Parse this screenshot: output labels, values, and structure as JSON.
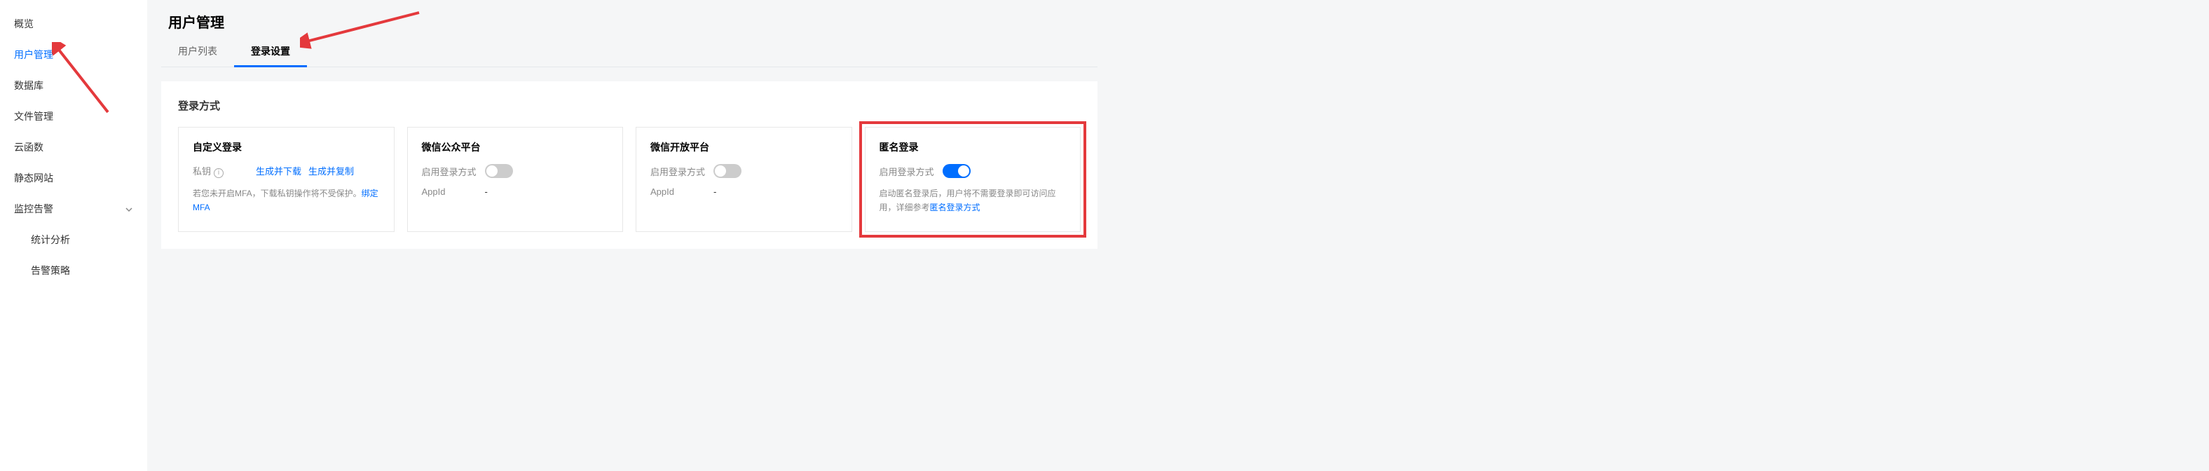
{
  "sidebar": {
    "items": [
      {
        "label": "概览",
        "active": false
      },
      {
        "label": "用户管理",
        "active": true
      },
      {
        "label": "数据库",
        "active": false
      },
      {
        "label": "文件管理",
        "active": false
      },
      {
        "label": "云函数",
        "active": false
      },
      {
        "label": "静态网站",
        "active": false
      },
      {
        "label": "监控告警",
        "active": false,
        "expandable": true
      },
      {
        "label": "统计分析",
        "active": false,
        "sub": true
      },
      {
        "label": "告警策略",
        "active": false,
        "sub": true
      }
    ]
  },
  "header": {
    "title": "用户管理"
  },
  "tabs": [
    {
      "label": "用户列表",
      "active": false
    },
    {
      "label": "登录设置",
      "active": true
    }
  ],
  "panel": {
    "title": "登录方式"
  },
  "cards": {
    "custom": {
      "title": "自定义登录",
      "private_key_label": "私钥",
      "link_generate_download": "生成并下载",
      "link_generate_copy": "生成并复制",
      "desc_prefix": "若您未开启MFA，下载私钥操作将不受保护。",
      "desc_link": "绑定MFA"
    },
    "wx_mp": {
      "title": "微信公众平台",
      "enable_label": "启用登录方式",
      "enabled": false,
      "appid_label": "AppId",
      "appid_value": "-"
    },
    "wx_open": {
      "title": "微信开放平台",
      "enable_label": "启用登录方式",
      "enabled": false,
      "appid_label": "AppId",
      "appid_value": "-"
    },
    "anon": {
      "title": "匿名登录",
      "enable_label": "启用登录方式",
      "enabled": true,
      "desc_prefix": "启动匿名登录后，用户将不需要登录即可访问应用，详细参考",
      "desc_link": "匿名登录方式"
    }
  }
}
